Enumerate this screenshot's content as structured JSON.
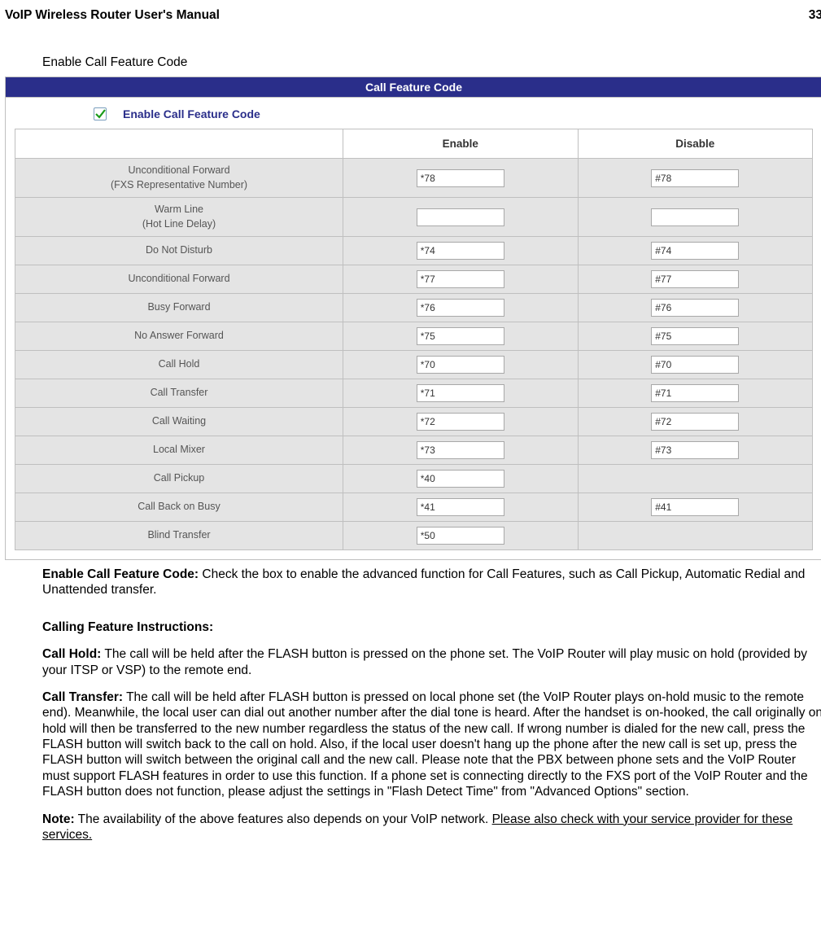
{
  "header": {
    "doc_title": "VoIP Wireless Router User's Manual",
    "page_number": "33"
  },
  "section_title": "Enable Call Feature Code",
  "panel": {
    "title": "Call Feature Code",
    "enable_label": "Enable Call Feature Code",
    "checked": true,
    "columns": {
      "feature": "",
      "enable": "Enable",
      "disable": "Disable"
    },
    "rows": [
      {
        "feature_line1": "Unconditional Forward",
        "feature_line2": "(FXS Representative Number)",
        "enable_val": "*78",
        "disable_val": "#78",
        "show_disable": true
      },
      {
        "feature_line1": "Warm Line",
        "feature_line2": "(Hot Line Delay)",
        "enable_val": "",
        "disable_val": "",
        "show_disable": true
      },
      {
        "feature_line1": "Do Not Disturb",
        "feature_line2": "",
        "enable_val": "*74",
        "disable_val": "#74",
        "show_disable": true
      },
      {
        "feature_line1": "Unconditional Forward",
        "feature_line2": "",
        "enable_val": "*77",
        "disable_val": "#77",
        "show_disable": true
      },
      {
        "feature_line1": "Busy Forward",
        "feature_line2": "",
        "enable_val": "*76",
        "disable_val": "#76",
        "show_disable": true
      },
      {
        "feature_line1": "No Answer Forward",
        "feature_line2": "",
        "enable_val": "*75",
        "disable_val": "#75",
        "show_disable": true
      },
      {
        "feature_line1": "Call Hold",
        "feature_line2": "",
        "enable_val": "*70",
        "disable_val": "#70",
        "show_disable": true
      },
      {
        "feature_line1": "Call Transfer",
        "feature_line2": "",
        "enable_val": "*71",
        "disable_val": "#71",
        "show_disable": true
      },
      {
        "feature_line1": "Call Waiting",
        "feature_line2": "",
        "enable_val": "*72",
        "disable_val": "#72",
        "show_disable": true
      },
      {
        "feature_line1": "Local Mixer",
        "feature_line2": "",
        "enable_val": "*73",
        "disable_val": "#73",
        "show_disable": true
      },
      {
        "feature_line1": "Call Pickup",
        "feature_line2": "",
        "enable_val": "*40",
        "disable_val": "",
        "show_disable": false
      },
      {
        "feature_line1": "Call Back on Busy",
        "feature_line2": "",
        "enable_val": "*41",
        "disable_val": "#41",
        "show_disable": true
      },
      {
        "feature_line1": "Blind Transfer",
        "feature_line2": "",
        "enable_val": "*50",
        "disable_val": "",
        "show_disable": false
      }
    ]
  },
  "prose": {
    "enable_heading": "Enable Call Feature Code:",
    "enable_body": " Check the box to enable the advanced function for Call Features, such as Call Pickup, Automatic Redial and Unattended transfer.",
    "instr_heading": "Calling Feature Instructions:",
    "hold_heading": "Call Hold:",
    "hold_body": " The call will be held after the FLASH button is pressed on the phone set. The VoIP Router will play music on hold (provided by your ITSP or VSP) to the remote end.",
    "transfer_heading": "Call Transfer:",
    "transfer_body": " The call will be held after FLASH button is pressed on local phone set (the VoIP Router plays on-hold music to the remote end). Meanwhile, the local user can dial out another number after the dial tone is heard. After the handset is on-hooked, the call originally on hold will then be transferred to the new number regardless the status of the new call. If wrong number is dialed for the new call, press the FLASH button will switch back to the call on hold. Also, if the local user doesn't hang up the phone after the new call is set up, press the FLASH button will switch between the original call and the new call. Please note that the PBX between phone sets and the VoIP Router must support FLASH features in order to use this function. If a phone set is connecting directly to the FXS port of the VoIP Router and the FLASH button does not function, please adjust the settings in \"Flash Detect Time\" from \"Advanced Options\" section.",
    "note_heading": "Note:",
    "note_body_1": " The availability of the above features also depends on your VoIP network. ",
    "note_body_2": "Please also check with your service provider for these services."
  }
}
